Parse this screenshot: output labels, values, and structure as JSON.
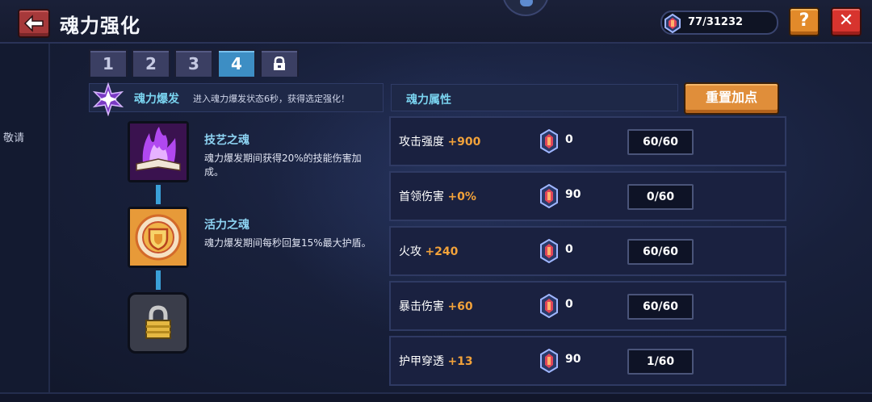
{
  "header": {
    "title": "魂力强化",
    "currency": {
      "value": "77/31232",
      "icon": "soul-gem-icon"
    },
    "help_label": "?",
    "close_label": "✕"
  },
  "side": {
    "text": "敬请"
  },
  "tabs": [
    {
      "label": "1",
      "active": false
    },
    {
      "label": "2",
      "active": false
    },
    {
      "label": "3",
      "active": false
    },
    {
      "label": "4",
      "active": true
    },
    {
      "label": "",
      "icon": "lock-icon",
      "active": false
    }
  ],
  "burst": {
    "title": "魂力爆发",
    "description": "进入魂力爆发状态6秒，获得选定强化！"
  },
  "souls": [
    {
      "name": "技艺之魂",
      "description": "魂力爆发期间获得20%的技能伤害加成。",
      "icon": "purple-flame-book-icon"
    },
    {
      "name": "活力之魂",
      "description": "魂力爆发期间每秒回复15%最大护盾。",
      "icon": "golden-shield-icon"
    },
    {
      "name": "",
      "description": "",
      "icon": "padlock-icon",
      "locked": true
    }
  ],
  "attributes": {
    "header": "魂力属性",
    "reset_label": "重置加点",
    "rows": [
      {
        "name": "攻击强度",
        "bonus": "+900",
        "cost": "0",
        "level": "60/60"
      },
      {
        "name": "首领伤害",
        "bonus": "+0%",
        "cost": "90",
        "level": "0/60"
      },
      {
        "name": "火攻",
        "bonus": "+240",
        "cost": "0",
        "level": "60/60"
      },
      {
        "name": "暴击伤害",
        "bonus": "+60",
        "cost": "0",
        "level": "60/60"
      },
      {
        "name": "护甲穿透",
        "bonus": "+13",
        "cost": "90",
        "level": "1/60"
      }
    ]
  },
  "colors": {
    "accent_blue": "#3d8ec4",
    "bonus_orange": "#f2a23a",
    "label_cyan": "#7ad4f0"
  }
}
